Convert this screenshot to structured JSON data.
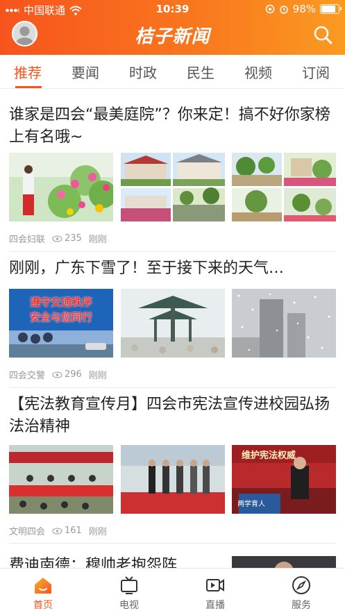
{
  "status_bar": {
    "carrier": "中国联通",
    "time": "10:39",
    "battery": "98%"
  },
  "header": {
    "title": "桔子新闻"
  },
  "tabs": [
    {
      "label": "推荐",
      "active": true
    },
    {
      "label": "要闻"
    },
    {
      "label": "时政"
    },
    {
      "label": "民生"
    },
    {
      "label": "视频"
    },
    {
      "label": "订阅"
    }
  ],
  "articles": [
    {
      "title": "谁家是四会“最美庭院”？你来定！搞不好你家榜上有名哦~",
      "source": "四会妇联",
      "views": "235",
      "time": "刚刚"
    },
    {
      "title": "刚刚，广东下雪了！至于接下来的天气…",
      "source": "四会交警",
      "views": "296",
      "time": "刚刚",
      "banner_line1": "遵守交通秩序",
      "banner_line2": "安全与您同行"
    },
    {
      "title": "【宪法教育宣传月】四会市宪法宣传进校园弘扬法治精神",
      "source": "文明四会",
      "views": "161",
      "time": "刚刚",
      "stage_banner": "维护宪法权威",
      "podium_text": "两学育人"
    },
    {
      "title": "费迪南德：穆帅老抱怨阵"
    }
  ],
  "bottom_nav": [
    {
      "label": "首页",
      "icon": "home-icon",
      "active": true
    },
    {
      "label": "电视",
      "icon": "tv-icon"
    },
    {
      "label": "直播",
      "icon": "live-icon"
    },
    {
      "label": "服务",
      "icon": "compass-icon"
    }
  ],
  "colors": {
    "accent": "#f5541d",
    "header_gradient_end": "#fb9b22"
  }
}
